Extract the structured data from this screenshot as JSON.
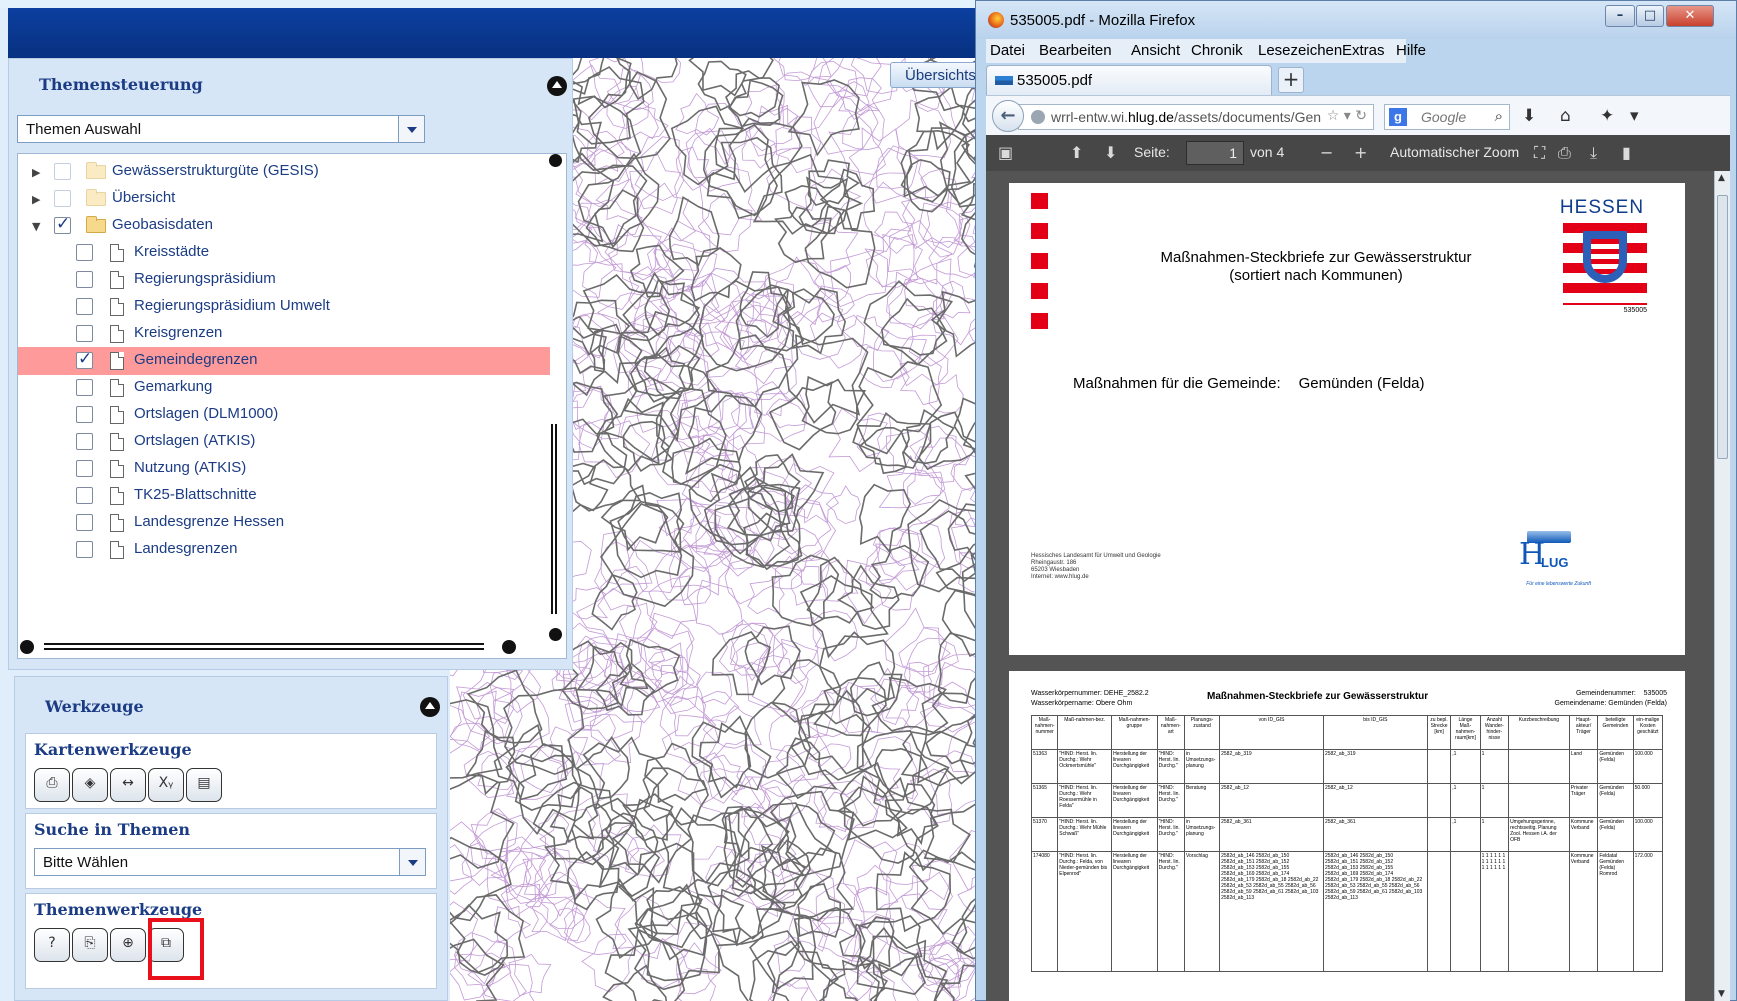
{
  "app": {
    "overview_button": "Übersichts",
    "themen_panel": {
      "title": "Themensteuerung",
      "select_value": "Themen Auswahl",
      "tree": [
        {
          "label": "Gewässerstrukturgüte (GESIS)",
          "type": "folder",
          "expand": "▶",
          "checked": false
        },
        {
          "label": "Übersicht",
          "type": "folder",
          "expand": "▶",
          "checked": false
        },
        {
          "label": "Geobasisdaten",
          "type": "folder",
          "expand": "▼",
          "checked": true
        },
        {
          "label": "Kreisstädte",
          "type": "layer",
          "checked": false
        },
        {
          "label": "Regierungspräsidium",
          "type": "layer",
          "checked": false
        },
        {
          "label": "Regierungspräsidium Umwelt",
          "type": "layer",
          "checked": false
        },
        {
          "label": "Kreisgrenzen",
          "type": "layer",
          "checked": false
        },
        {
          "label": "Gemeindegrenzen",
          "type": "layer",
          "checked": true,
          "selected": true
        },
        {
          "label": "Gemarkung",
          "type": "layer",
          "checked": false
        },
        {
          "label": "Ortslagen (DLM1000)",
          "type": "layer",
          "checked": false
        },
        {
          "label": "Ortslagen (ATKIS)",
          "type": "layer",
          "checked": false
        },
        {
          "label": "Nutzung (ATKIS)",
          "type": "layer",
          "checked": false
        },
        {
          "label": "TK25-Blattschnitte",
          "type": "layer",
          "checked": false
        },
        {
          "label": "Landesgrenze Hessen",
          "type": "layer",
          "checked": false
        },
        {
          "label": "Landesgrenzen",
          "type": "layer",
          "checked": false
        }
      ]
    },
    "werkzeuge_panel": {
      "title": "Werkzeuge",
      "karten": {
        "title": "Kartenwerkzeuge",
        "buttons": [
          {
            "name": "print-icon",
            "glyph": "⎙"
          },
          {
            "name": "layers-icon",
            "glyph": "◈"
          },
          {
            "name": "measure-icon",
            "glyph": "↔"
          },
          {
            "name": "xy-coordinates-icon",
            "glyph": "Xᵧ"
          },
          {
            "name": "export-icon",
            "glyph": "▤"
          }
        ]
      },
      "suche": {
        "title": "Suche in Themen",
        "select_value": "Bitte Wählen"
      },
      "themen": {
        "title": "Themenwerkzeuge",
        "buttons": [
          {
            "name": "info-icon",
            "glyph": "?"
          },
          {
            "name": "report-icon",
            "glyph": "⎘"
          },
          {
            "name": "search-zoom-icon",
            "glyph": "⊕"
          },
          {
            "name": "query-icon",
            "glyph": "⧉"
          }
        ]
      }
    },
    "highlight_color": "#e8101a",
    "selected_row_color": "#ff9a9a"
  },
  "firefox": {
    "window_title": "535005.pdf - Mozilla Firefox",
    "menu": [
      "Datei",
      "Bearbeiten",
      "Ansicht",
      "Chronik",
      "Lesezeichen",
      "Extras",
      "Hilfe"
    ],
    "tab_title": "535005.pdf",
    "url_prefix": "wrrl-entw.wi.",
    "url_host": "hlug.de",
    "url_path": "/assets/documents/Gen",
    "search_placeholder": "Google",
    "pdf_toolbar": {
      "page_label": "Seite:",
      "page_value": "1",
      "page_total": "von 4",
      "zoom": "Automatischer Zoom"
    }
  },
  "pdf": {
    "page1": {
      "title_line1": "Maßnahmen-Steckbriefe zur Gewässerstruktur",
      "title_line2": "(sortiert nach Kommunen)",
      "logo_text": "HESSEN",
      "doc_id": "535005",
      "gemeinde_label": "Maßnahmen für die Gemeinde:",
      "gemeinde_value": "Gemünden (Felda)",
      "footer": "Hessisches Landesamt für Umwelt und Geologie\nRheingaustr. 186\n65203 Wiesbaden\nInternet: www.hlug.de",
      "hlug_logo": "H",
      "hlug_logo_small": "LUG",
      "hlug_tagline": "Für eine lebenswerte Zukunft"
    },
    "page2": {
      "head_left": "Wasserkörpernummer: DEHE_2582.2\nWasserkörpername: Obere Ohm",
      "title": "Maßnahmen-Steckbriefe zur Gewässerstruktur",
      "head_right": "Gemeindenummer:    535005\nGemeindename: Gemünden (Felda)",
      "columns": [
        "Maß-nahmen-nummer",
        "Maß-nahmen-bez.",
        "Maß-nahmen-gruppe",
        "Maß-nahmen-art",
        "Planungs-zustand",
        "von ID_GIS",
        "bis ID_GIS",
        "zu bepl. Strecke [km]",
        "Länge Maß-nahmen-raum[km]",
        "Anzahl Wander-hinder-nisse",
        "Kurzbeschreibung",
        "Haupt-akteur/ Träger",
        "beteiligte Gemeinden",
        "ein-malige Kosten geschätzt"
      ],
      "rows": [
        [
          "51363",
          "\"HIND: Herst. lin. Durchg.: Wehr Ockmertsmühle\"",
          "Herstellung der linearen Durchgängigkeit",
          "\"HIND: Herst. lin. Durchg.\"",
          "in Umsetzungs-planung",
          "2582_ab_319",
          "2582_ab_319",
          "",
          ",1",
          "1",
          "",
          "Land",
          "Gemünden (Felda)",
          "100.000"
        ],
        [
          "51365",
          "\"HIND: Herst. lin. Durchg.: Wehr Roessermühle in Felda\"",
          "Herstellung der linearen Durchgängigkeit",
          "\"HIND: Herst. lin. Durchg.\"",
          "Beratung",
          "2582_ab_12",
          "2582_ab_12",
          "",
          ",1",
          "1",
          "",
          "Privater Träger",
          "Gemünden (Felda)",
          "50.000"
        ],
        [
          "51370",
          "\"HIND: Herst. lin. Durchg.: Wehr Mühle Schwaß\"",
          "Herstellung der linearen Durchgängigkeit",
          "\"HIND: Herst. lin. Durchg.\"",
          "in Umsetzungs-planung",
          "2582_ab_361",
          "2582_ab_361",
          "",
          ",1",
          "1",
          "Umgehungsgerinne, rechtsseitig. Planung Zool. Hessen i.A. der OFB",
          "Kommune Verband",
          "Gemünden (Felda)",
          "100.000"
        ],
        [
          "174080",
          "\"HIND: Herst. lin. Durchg.: Felda, von Nieder-gemünden bis Elpenrod\"",
          "Herstellung der linearen Durchgängigkeit",
          "\"HIND: Herst. lin. Durchg.\"",
          "Vorschlag",
          "2582d_ab_146 2582d_ab_150 2582d_ab_151 2582d_ab_152 2582d_ab_153 2582d_ab_155 2582d_ab_169 2582d_ab_174 2582d_ab_179 2582d_ab_18 2582d_ab_22 2582d_ab_53 2582d_ab_55 2582d_ab_56 2582d_ab_59 2582d_ab_61 2582d_ab_103 2582d_ab_113",
          "2582d_ab_146 2582d_ab_150 2582d_ab_151 2582d_ab_152 2582d_ab_153 2582d_ab_155 2582d_ab_169 2582d_ab_174 2582d_ab_179 2582d_ab_18 2582d_ab_22 2582d_ab_53 2582d_ab_55 2582d_ab_56 2582d_ab_59 2582d_ab_61 2582d_ab_103 2582d_ab_113",
          "",
          "",
          "1 1 1 1 1 1 1 1 1 1 1 1 1 1 1 1 1 1",
          "",
          "Kommune Verband",
          "Feldatal Gemünden (Felda) Romrod",
          "172.000"
        ]
      ]
    }
  }
}
